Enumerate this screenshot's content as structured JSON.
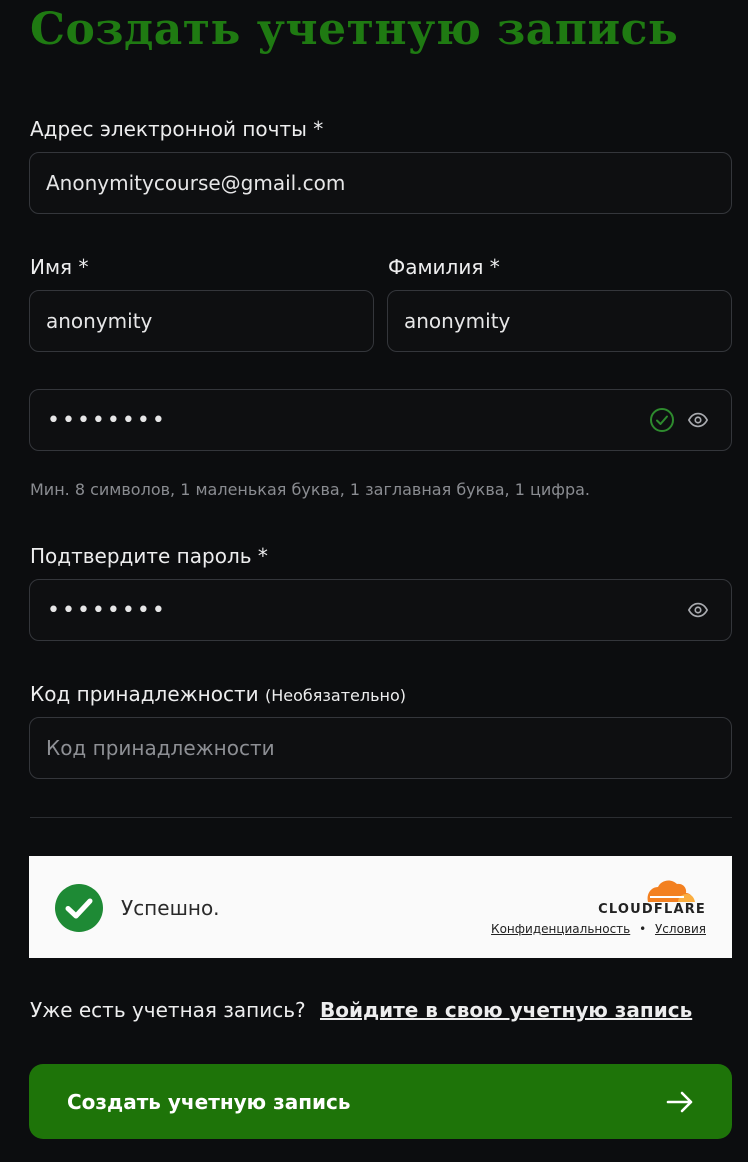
{
  "page": {
    "title": "Создать учетную запись"
  },
  "form": {
    "email": {
      "label": "Адрес электронной почты *",
      "value": "Anonymitycourse@gmail.com"
    },
    "first_name": {
      "label": "Имя *",
      "value": "anonymity"
    },
    "last_name": {
      "label": "Фамилия *",
      "value": "anonymity"
    },
    "password": {
      "value": "••••••••",
      "valid_icon": "check-circle-icon",
      "reveal_icon": "eye-icon"
    },
    "password_hint": "Мин. 8 символов, 1 маленькая буква, 1 заглавная буква, 1 цифра.",
    "confirm_password": {
      "label": "Подтвердите пароль *",
      "value": "••••••••",
      "reveal_icon": "eye-icon"
    },
    "affiliation": {
      "label": "Код принадлежности",
      "label_optional": "(Необязательно)",
      "placeholder": "Код принадлежности"
    }
  },
  "captcha": {
    "status": "Успешно.",
    "brand": "CLOUDFLARE",
    "privacy_link": "Конфиденциальность",
    "separator": "•",
    "terms_link": "Условия"
  },
  "signin": {
    "prompt": "Уже есть учетная запись?",
    "link": "Войдите в свою учетную запись"
  },
  "submit": {
    "label": "Создать учетную запись",
    "icon": "arrow-right-icon"
  },
  "colors": {
    "background": "#0c0d0f",
    "accent_green": "#1e7409",
    "title_green": "#1f7a12",
    "valid_green": "#2e8b2e",
    "cloudflare_orange": "#f38020"
  }
}
